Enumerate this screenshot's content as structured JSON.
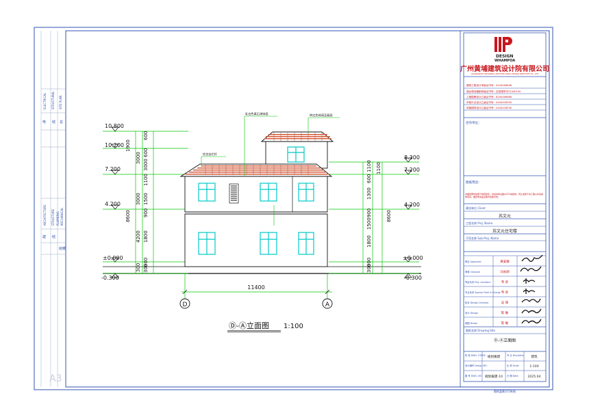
{
  "sheet": {
    "size_label": "A3"
  },
  "left_strip": {
    "group_top": [
      "ELECTRICAL",
      "STRUCTURAL",
      "SITE PLAN"
    ],
    "group_mid": [
      "ARCHITECTURE",
      "STRUCTURE",
      "PLUMBING",
      "MECHANICAL"
    ],
    "cn_top": [
      "电",
      "结",
      "总"
    ],
    "cn_mid": [
      "建",
      "结",
      "给",
      "暖"
    ]
  },
  "title_block": {
    "logo_text": "DESIGN",
    "logo_sub": "WHAMPOA",
    "company_cn": "广州黄埔建筑设计院有限公司",
    "company_en": "GUANGZHOU WHAMPOA ARCHITECTURAL DESIGN INSTITUTE CO., LTD",
    "certs": [
      "建筑工程设计甲级证书号：A144006648",
      "城乡规划编制甲级证书号：自资规甲字22440130",
      "工程勘察设计乙级证书号：B244006666",
      "市政行业设计乙级证书号：A244018930",
      "风景园林设计乙级证书号：A244018930"
    ],
    "cooperation_label": "合作单位：",
    "notes_label": "图纸用途：",
    "notes_text": "本图纸著作权属于我院所有，未经本院书面许可不得复制、转让或用于本工程以外的其他项目。图纸未加盖出图专用章无效。",
    "client_label": "建设单位 Client",
    "client_value": "苏文元",
    "project_label": "工程名称 Proj. Name",
    "project_value": "苏文元住宅楼",
    "subproject_label": "子项名称 Sub-Proj. Name",
    "sign_rows": [
      {
        "role": "审定 Approved",
        "name": "黄安耀"
      },
      {
        "role": "审核 Checked",
        "name": "刘永刚"
      },
      {
        "role": "项目负责 Proj. Architect",
        "name": "韦 昇"
      },
      {
        "role": "专业负责 Special Field in Charge",
        "name": "韦 昇"
      },
      {
        "role": "校对 Design Checked",
        "name": "吴 辉"
      },
      {
        "role": "设计 Design",
        "name": "陈 敏"
      },
      {
        "role": "制图 Drawn",
        "name": "陈 敏"
      }
    ],
    "drawing_title_label": "图纸名称 Drawing title",
    "drawing_title_value": "Ⓓ-Ⓐ立面图",
    "bottom": {
      "stage_label": "阶 段 DWG. STAGE",
      "stage_value": "规划报建",
      "discipline_label": "专 业 Discipline",
      "discipline_value": "建筑",
      "design_no_label": "设计编号 Design NO.",
      "scale_label": "比 例 Scale",
      "scale_value": "1:100",
      "dwg_no_label": "图 号 DWG. NO.",
      "dwg_no_value": "规划报建-10",
      "date_label": "日 期 Date",
      "date_value": "2025.04"
    },
    "footer_note": "图纸盖章方可有效"
  },
  "drawing": {
    "title": "Ⓓ-Ⓐ立面图",
    "scale": "1:100",
    "axis_left": "D",
    "axis_right": "A",
    "overall_dim": "11400",
    "left_levels": [
      "10.800",
      "10.200",
      "7.200",
      "4.200",
      "±0.000",
      "-0.300"
    ],
    "right_levels": [
      "8.300",
      "7.200",
      "4.200",
      "±0.000",
      "-0.300"
    ],
    "left_dims_outer": [
      "1900",
      "3000",
      "8600"
    ],
    "left_dims_inner": [
      "600",
      "3000",
      "600",
      "1100",
      "3000",
      "1500",
      "900",
      "4200",
      "1800",
      "300",
      "900",
      "300"
    ],
    "right_dims_inner": [
      "1100",
      "600",
      "1100",
      "1300",
      "900",
      "1500",
      "1800",
      "900",
      "300"
    ],
    "right_dims_outer": [
      "8600"
    ],
    "callouts": [
      "乳白色真石漆饰面",
      "砖红色琉璃瓦屋面",
      "铝合金栏杆"
    ]
  }
}
